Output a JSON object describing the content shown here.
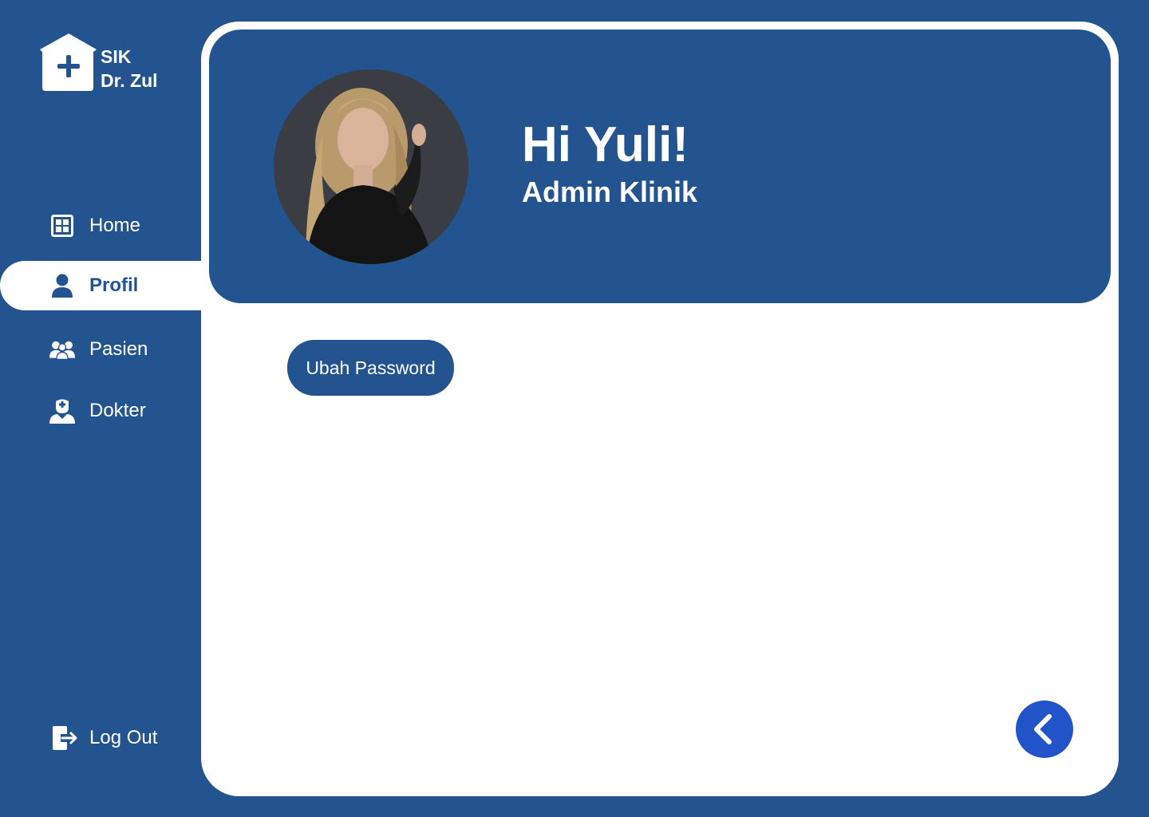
{
  "app": {
    "title_line1": "SIK",
    "title_line2": "Dr. Zul"
  },
  "sidebar": {
    "items": [
      {
        "label": "Home",
        "icon": "dashboard-grid-icon",
        "active": false
      },
      {
        "label": "Profil",
        "icon": "user-icon",
        "active": true
      },
      {
        "label": "Pasien",
        "icon": "users-group-icon",
        "active": false
      },
      {
        "label": "Dokter",
        "icon": "doctor-icon",
        "active": false
      }
    ],
    "logout_label": "Log Out",
    "logout_icon": "logout-icon"
  },
  "profile": {
    "greeting": "Hi Yuli!",
    "role": "Admin Klinik",
    "change_password_label": "Ubah Password",
    "back_icon": "chevron-left-icon"
  },
  "colors": {
    "primary": "#23548f",
    "accent": "#2254c9",
    "surface": "#ffffff"
  }
}
